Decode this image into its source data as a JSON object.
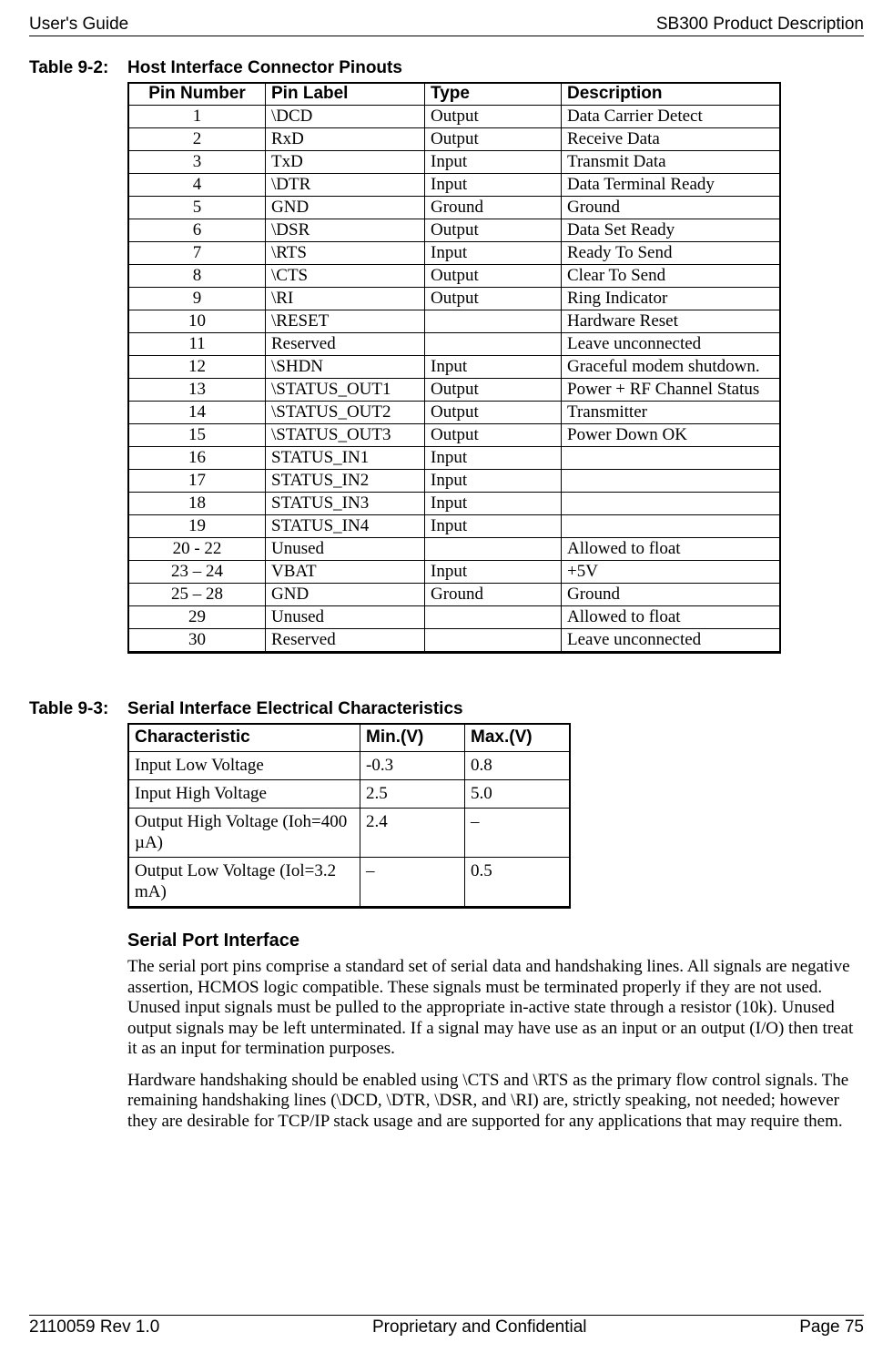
{
  "header": {
    "left": "User's Guide",
    "right": "SB300 Product Description"
  },
  "footer": {
    "left": "2110059 Rev 1.0",
    "center": "Proprietary and Confidential",
    "right": "Page 75"
  },
  "table1": {
    "caption_label": "Table 9-2:",
    "caption_title": "Host Interface Connector Pinouts",
    "headers": [
      "Pin Number",
      "Pin Label",
      "Type",
      "Description"
    ],
    "rows": [
      [
        "1",
        "\\DCD",
        "Output",
        "Data Carrier Detect"
      ],
      [
        "2",
        "RxD",
        "Output",
        "Receive Data"
      ],
      [
        "3",
        "TxD",
        "Input",
        "Transmit Data"
      ],
      [
        "4",
        "\\DTR",
        "Input",
        "Data Terminal Ready"
      ],
      [
        "5",
        "GND",
        "Ground",
        "Ground"
      ],
      [
        "6",
        "\\DSR",
        "Output",
        "Data Set Ready"
      ],
      [
        "7",
        "\\RTS",
        "Input",
        "Ready To Send"
      ],
      [
        "8",
        "\\CTS",
        "Output",
        "Clear To Send"
      ],
      [
        "9",
        "\\RI",
        "Output",
        "Ring Indicator"
      ],
      [
        "10",
        "\\RESET",
        "",
        "Hardware Reset"
      ],
      [
        "11",
        "Reserved",
        "",
        "Leave unconnected"
      ],
      [
        "12",
        "\\SHDN",
        "Input",
        "Graceful modem shutdown."
      ],
      [
        "13",
        "\\STATUS_OUT1",
        "Output",
        "Power + RF Channel Status"
      ],
      [
        "14",
        "\\STATUS_OUT2",
        "Output",
        "Transmitter"
      ],
      [
        "15",
        "\\STATUS_OUT3",
        "Output",
        "Power Down OK"
      ],
      [
        "16",
        "STATUS_IN1",
        "Input",
        ""
      ],
      [
        "17",
        "STATUS_IN2",
        "Input",
        ""
      ],
      [
        "18",
        "STATUS_IN3",
        "Input",
        ""
      ],
      [
        "19",
        "STATUS_IN4",
        "Input",
        ""
      ],
      [
        "20 - 22",
        "Unused",
        "",
        "Allowed to float"
      ],
      [
        "23 – 24",
        "VBAT",
        "Input",
        "+5V"
      ],
      [
        "25 – 28",
        "GND",
        "Ground",
        "Ground"
      ],
      [
        "29",
        "Unused",
        "",
        "Allowed to float"
      ],
      [
        "30",
        "Reserved",
        "",
        "Leave unconnected"
      ]
    ]
  },
  "table2": {
    "caption_label": "Table 9-3:",
    "caption_title": "Serial Interface Electrical Characteristics",
    "headers": [
      "Characteristic",
      "Min.(V)",
      "Max.(V)"
    ],
    "rows": [
      [
        "Input Low Voltage",
        "-0.3",
        "0.8"
      ],
      [
        "Input High Voltage",
        "2.5",
        "5.0"
      ],
      [
        "Output High Voltage (Ioh=400 µA)",
        "2.4",
        "–"
      ],
      [
        "Output Low Voltage (Iol=3.2 mA)",
        "–",
        "0.5"
      ]
    ]
  },
  "section": {
    "heading": "Serial Port Interface",
    "p1": "The serial port pins comprise a standard set of serial data and handshaking lines.  All signals are negative assertion, HCMOS logic compatible.  These signals must be terminated properly if they are not used.  Unused input signals must be pulled to the appropriate in-active state through a resistor (10k).  Unused output signals may be left unterminated.  If a signal may have use as an input or an output (I/O) then treat it as an input for termination purposes.",
    "p2": "Hardware handshaking should be enabled using \\CTS and \\RTS as the primary flow control signals.  The remaining handshaking lines (\\DCD, \\DTR, \\DSR, and \\RI) are, strictly speaking, not needed; however they are desirable for TCP/IP stack usage and are supported for any applications that may require them."
  }
}
